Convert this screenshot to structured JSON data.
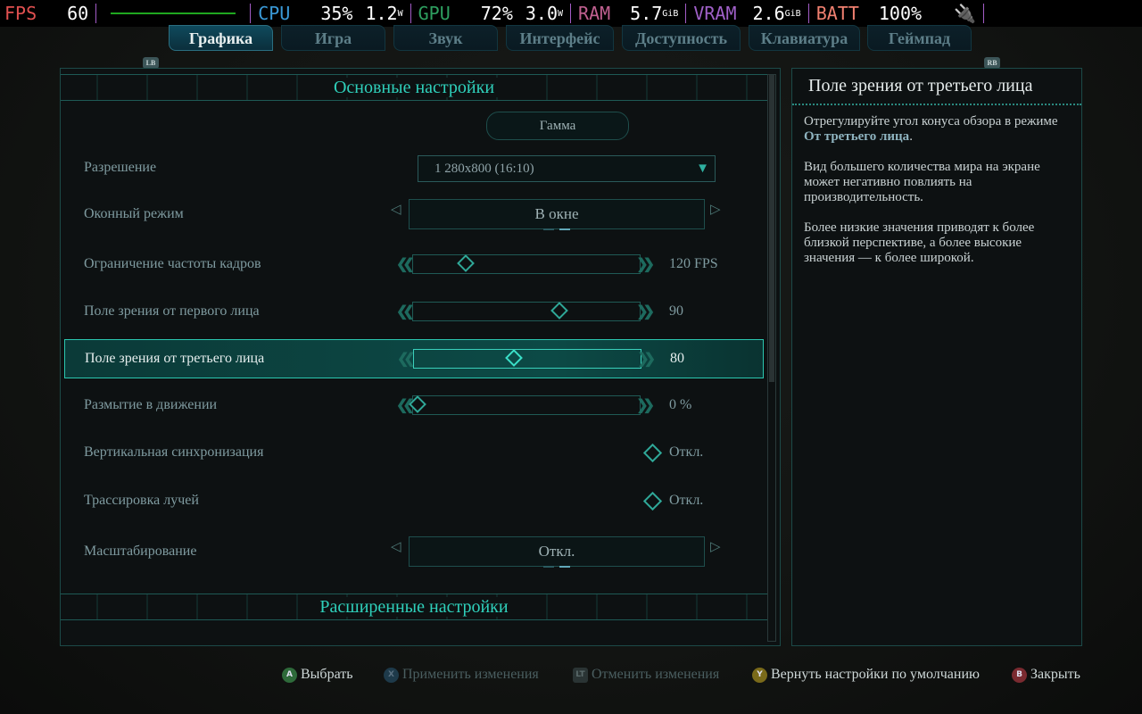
{
  "hud": {
    "fps_label": "FPS",
    "fps": "60",
    "cpu_label": "CPU",
    "cpu_pct": "35%",
    "cpu_w": "1.2",
    "gpu_label": "GPU",
    "gpu_pct": "72%",
    "gpu_w": "3.0",
    "w_unit": "W",
    "ram_label": "RAM",
    "ram": "5.7",
    "vram_label": "VRAM",
    "vram": "2.6",
    "gib": "GiB",
    "batt_label": "BATT",
    "batt": "100%",
    "colors": {
      "fps": "#e05050",
      "cpu": "#3a9ad8",
      "gpu": "#2ea060",
      "ram": "#c06090",
      "vram": "#a060c8",
      "batt": "#f08070"
    }
  },
  "tabs": {
    "lb": "LB",
    "rb": "RB",
    "items": [
      "Графика",
      "Игра",
      "Звук",
      "Интерфейс",
      "Доступность",
      "Клавиатура",
      "Геймпад"
    ]
  },
  "main": {
    "section1": "Основные настройки",
    "gamma": "Гамма",
    "section2": "Расширенные настройки",
    "rows": {
      "resolution": {
        "label": "Разрешение",
        "value": "1 280x800 (16:10)"
      },
      "window": {
        "label": "Оконный режим",
        "value": "В окне"
      },
      "fps": {
        "label": "Ограничение частоты кадров",
        "value": "120 FPS",
        "fraction": 0.22
      },
      "fov1": {
        "label": "Поле зрения от первого лица",
        "value": "90",
        "fraction": 0.65
      },
      "fov3": {
        "label": "Поле зрения от третьего лица",
        "value": "80",
        "fraction": 0.44
      },
      "blur": {
        "label": "Размытие в движении",
        "value": "0 %",
        "fraction": 0
      },
      "vsync": {
        "label": "Вертикальная синхронизация",
        "value": "Откл."
      },
      "rt": {
        "label": "Трассировка лучей",
        "value": "Откл."
      },
      "scaling": {
        "label": "Масштабирование",
        "value": "Откл."
      }
    }
  },
  "info": {
    "title": "Поле зрения от третьего лица",
    "p1a": "Отрегулируйте угол конуса обзора в режиме ",
    "p1b": "От третьего лица",
    "p1c": ".",
    "p2": "Вид большего количества мира на экране может негативно повлиять на производительность.",
    "p3": "Более низкие значения приводят к более близкой перспективе, а более высокие значения — к более широкой."
  },
  "footer": {
    "select": "Выбрать",
    "apply": "Применить изменения",
    "revert": "Отменить изменения",
    "defaults": "Вернуть настройки по умолчанию",
    "close": "Закрыть",
    "a": "A",
    "x": "X",
    "lt": "LT",
    "y": "Y",
    "b": "B"
  }
}
